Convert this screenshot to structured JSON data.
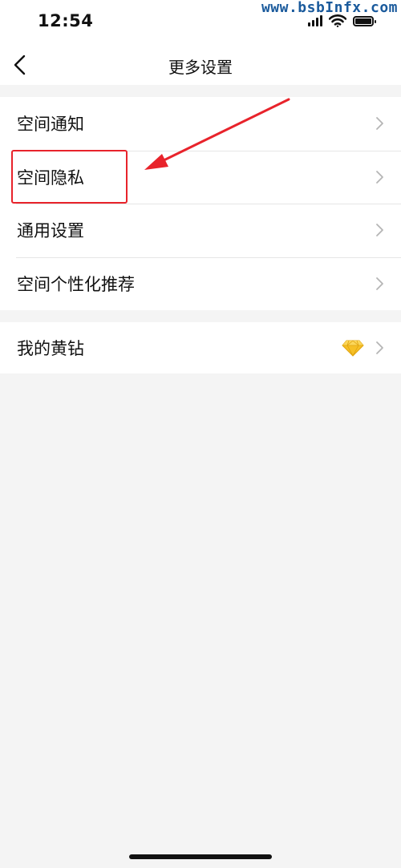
{
  "status_bar": {
    "time": "12:54"
  },
  "watermark": {
    "text": "www.bsbInfx.com",
    "color": "#1a5a9c"
  },
  "nav": {
    "title": "更多设置"
  },
  "settings_group": {
    "items": [
      {
        "label": "空间通知"
      },
      {
        "label": "空间隐私"
      },
      {
        "label": "通用设置"
      },
      {
        "label": "空间个性化推荐"
      }
    ]
  },
  "vip_group": {
    "label": "我的黄钻"
  },
  "icons": {
    "back": "chevron-left-icon",
    "chevron": "chevron-right-icon",
    "diamond": "yellow-diamond-icon"
  },
  "colors": {
    "annotation_red": "#e8232b",
    "background": "#f4f4f4",
    "chevron": "#b5b5b5",
    "diamond": "#f6c026"
  }
}
